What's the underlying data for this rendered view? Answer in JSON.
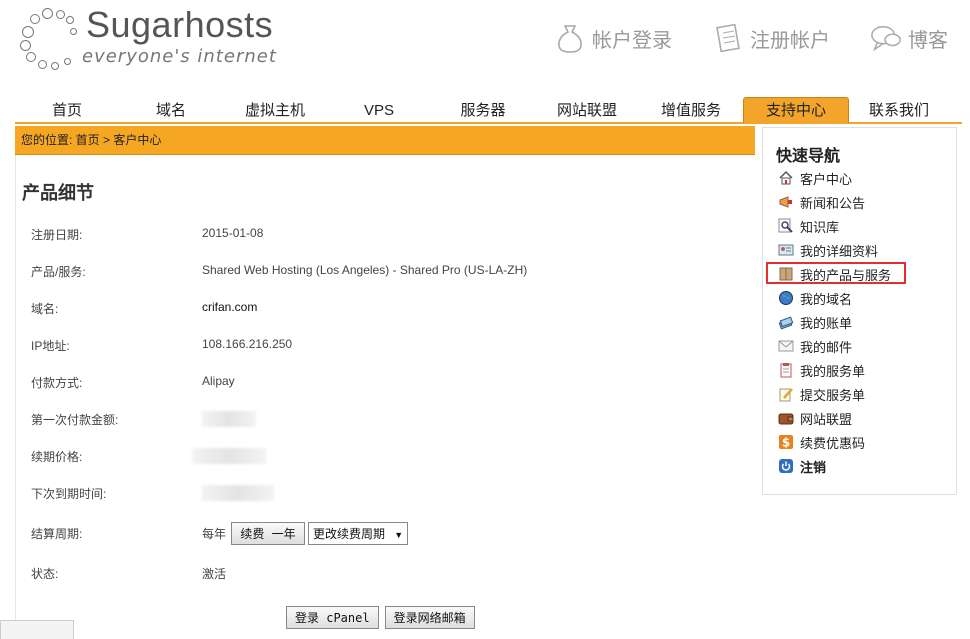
{
  "header": {
    "logo_name": "Sugarhosts",
    "logo_tagline": "everyone's internet",
    "toplinks": [
      {
        "label": "帐户登录",
        "icon": "money-bag-icon"
      },
      {
        "label": "注册帐户",
        "icon": "document-icon"
      },
      {
        "label": "博客",
        "icon": "chat-bubble-icon"
      }
    ]
  },
  "nav": {
    "items": [
      "首页",
      "域名",
      "虚拟主机",
      "VPS",
      "服务器",
      "网站联盟",
      "增值服务",
      "支持中心",
      "联系我们"
    ],
    "active_index": 7
  },
  "breadcrumb": "您的位置: 首页 > 客户中心",
  "page_title": "产品细节",
  "details": [
    {
      "label": "注册日期:",
      "value": "2015-01-08"
    },
    {
      "label": "产品/服务:",
      "value": "Shared Web Hosting (Los Angeles) - Shared Pro (US-LA-ZH)"
    },
    {
      "label": "域名:",
      "value": "crifan.com"
    },
    {
      "label": "IP地址:",
      "value": "108.166.216.250"
    },
    {
      "label": "付款方式:",
      "value": "Alipay"
    },
    {
      "label": "第一次付款金额:",
      "value": ""
    },
    {
      "label": "续期价格:",
      "value": ""
    },
    {
      "label": "下次到期时间:",
      "value": ""
    },
    {
      "label": "结算周期:",
      "value": "每年"
    },
    {
      "label": "状态:",
      "value": "激活"
    }
  ],
  "billing": {
    "renew_button": "续费 一年",
    "change_cycle_select": "更改续费周期"
  },
  "actions": {
    "cpanel_button": "登录 cPanel",
    "webmail_button": "登录网络邮箱"
  },
  "sidebar": {
    "title": "快速导航",
    "items": [
      {
        "label": "客户中心",
        "icon": "home-icon"
      },
      {
        "label": "新闻和公告",
        "icon": "megaphone-icon"
      },
      {
        "label": "知识库",
        "icon": "magnifier-icon"
      },
      {
        "label": "我的详细资料",
        "icon": "id-card-icon"
      },
      {
        "label": "我的产品与服务",
        "icon": "box-icon"
      },
      {
        "label": "我的域名",
        "icon": "globe-icon"
      },
      {
        "label": "我的账单",
        "icon": "money-stack-icon"
      },
      {
        "label": "我的邮件",
        "icon": "envelope-icon"
      },
      {
        "label": "我的服务单",
        "icon": "clipboard-icon"
      },
      {
        "label": "提交服务单",
        "icon": "pencil-note-icon"
      },
      {
        "label": "网站联盟",
        "icon": "wallet-icon"
      },
      {
        "label": "续费优惠码",
        "icon": "dollar-icon"
      },
      {
        "label": "注销",
        "icon": "power-icon"
      }
    ],
    "highlighted_index": 4
  },
  "colors": {
    "accent": "#f3a52b",
    "highlight_border": "#e03030"
  }
}
